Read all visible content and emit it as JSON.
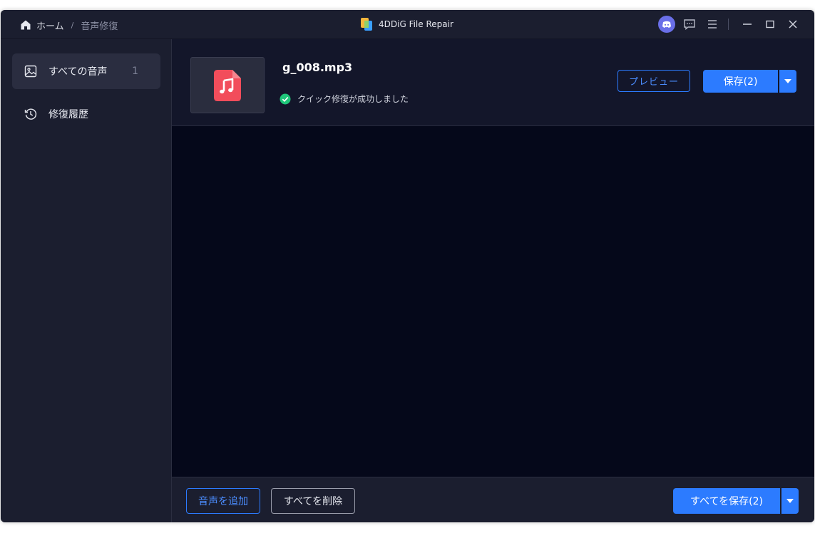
{
  "colors": {
    "window_bg": "#1b1e2f",
    "main_bg": "#05081a",
    "accent": "#2c7bff",
    "success": "#1fc67a",
    "file_icon": "#f24d5b",
    "discord": "#6a6fe8"
  },
  "titlebar": {
    "breadcrumb": {
      "home_icon": "home-icon",
      "home_label": "ホーム",
      "separator": "/",
      "current": "音声修復"
    },
    "app_title": "4DDiG File Repair",
    "icons": [
      "discord-icon",
      "feedback-icon",
      "menu-icon",
      "minimize-icon",
      "maximize-icon",
      "close-icon"
    ]
  },
  "sidebar": {
    "items": [
      {
        "icon": "image-icon",
        "label": "すべての音声",
        "count": "1",
        "active": true
      },
      {
        "icon": "history-icon",
        "label": "修復履歴",
        "active": false
      }
    ]
  },
  "file": {
    "name": "g_008.mp3",
    "icon": "music-file-icon",
    "status_icon": "check-circle-icon",
    "status": "クイック修復が成功しました",
    "preview_label": "プレビュー",
    "save_label": "保存(2)"
  },
  "footer": {
    "add_label": "音声を追加",
    "delete_all_label": "すべてを削除",
    "save_all_label": "すべてを保存(2)"
  }
}
